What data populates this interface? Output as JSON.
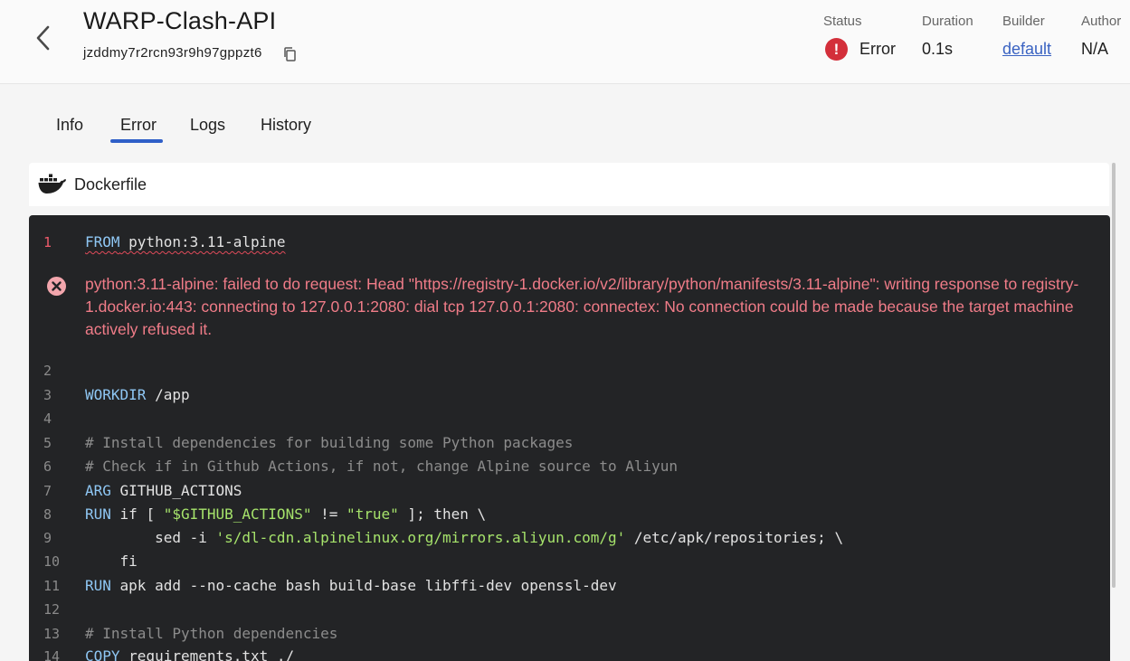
{
  "header": {
    "title": "WARP-Clash-API",
    "build_id": "jzddmy7r2rcn93r9h97gppzt6",
    "status_label": "Status",
    "status_value": "Error",
    "duration_label": "Duration",
    "duration_value": "0.1s",
    "builder_label": "Builder",
    "builder_value": "default",
    "author_label": "Author",
    "author_value": "N/A",
    "status_color": "#d32f3a"
  },
  "tabs": [
    {
      "label": "Info",
      "active": false
    },
    {
      "label": "Error",
      "active": true
    },
    {
      "label": "Logs",
      "active": false
    },
    {
      "label": "History",
      "active": false
    }
  ],
  "file": {
    "name": "Dockerfile",
    "icon": "docker-icon"
  },
  "code": {
    "error_message": "python:3.11-alpine: failed to do request: Head \"https://registry-1.docker.io/v2/library/python/manifests/3.11-alpine\": writing response to registry-1.docker.io:443: connecting to 127.0.0.1:2080: dial tcp 127.0.0.1:2080: connectex: No connection could be made because the target machine actively refused it.",
    "lines": [
      {
        "n": "1",
        "parts": [
          {
            "t": "FROM",
            "c": "kw"
          },
          {
            "t": " python:3.11-alpine",
            "c": ""
          }
        ]
      },
      {
        "n": "2",
        "parts": []
      },
      {
        "n": "3",
        "parts": [
          {
            "t": "WORKDIR",
            "c": "kw"
          },
          {
            "t": " /app",
            "c": ""
          }
        ]
      },
      {
        "n": "4",
        "parts": []
      },
      {
        "n": "5",
        "parts": [
          {
            "t": "# Install dependencies for building some Python packages",
            "c": "cm"
          }
        ]
      },
      {
        "n": "6",
        "parts": [
          {
            "t": "# Check if in Github Actions, if not, change Alpine source to Aliyun",
            "c": "cm"
          }
        ]
      },
      {
        "n": "7",
        "parts": [
          {
            "t": "ARG",
            "c": "kw"
          },
          {
            "t": " GITHUB_ACTIONS",
            "c": ""
          }
        ]
      },
      {
        "n": "8",
        "parts": [
          {
            "t": "RUN",
            "c": "kw"
          },
          {
            "t": " if [ ",
            "c": ""
          },
          {
            "t": "\"$GITHUB_ACTIONS\"",
            "c": "str"
          },
          {
            "t": " != ",
            "c": ""
          },
          {
            "t": "\"true\"",
            "c": "str"
          },
          {
            "t": " ]; then \\",
            "c": ""
          }
        ]
      },
      {
        "n": "9",
        "parts": [
          {
            "t": "        sed -i ",
            "c": ""
          },
          {
            "t": "'s/dl-cdn.alpinelinux.org/mirrors.aliyun.com/g'",
            "c": "str"
          },
          {
            "t": " /etc/apk/repositories; \\",
            "c": ""
          }
        ]
      },
      {
        "n": "10",
        "parts": [
          {
            "t": "    fi",
            "c": ""
          }
        ]
      },
      {
        "n": "11",
        "parts": [
          {
            "t": "RUN",
            "c": "kw"
          },
          {
            "t": " apk add --no-cache bash build-base libffi-dev openssl-dev",
            "c": ""
          }
        ]
      },
      {
        "n": "12",
        "parts": []
      },
      {
        "n": "13",
        "parts": [
          {
            "t": "# Install Python dependencies",
            "c": "cm"
          }
        ]
      },
      {
        "n": "14",
        "parts": [
          {
            "t": "COPY",
            "c": "kw"
          },
          {
            "t": " requirements.txt ./",
            "c": ""
          }
        ]
      }
    ]
  }
}
